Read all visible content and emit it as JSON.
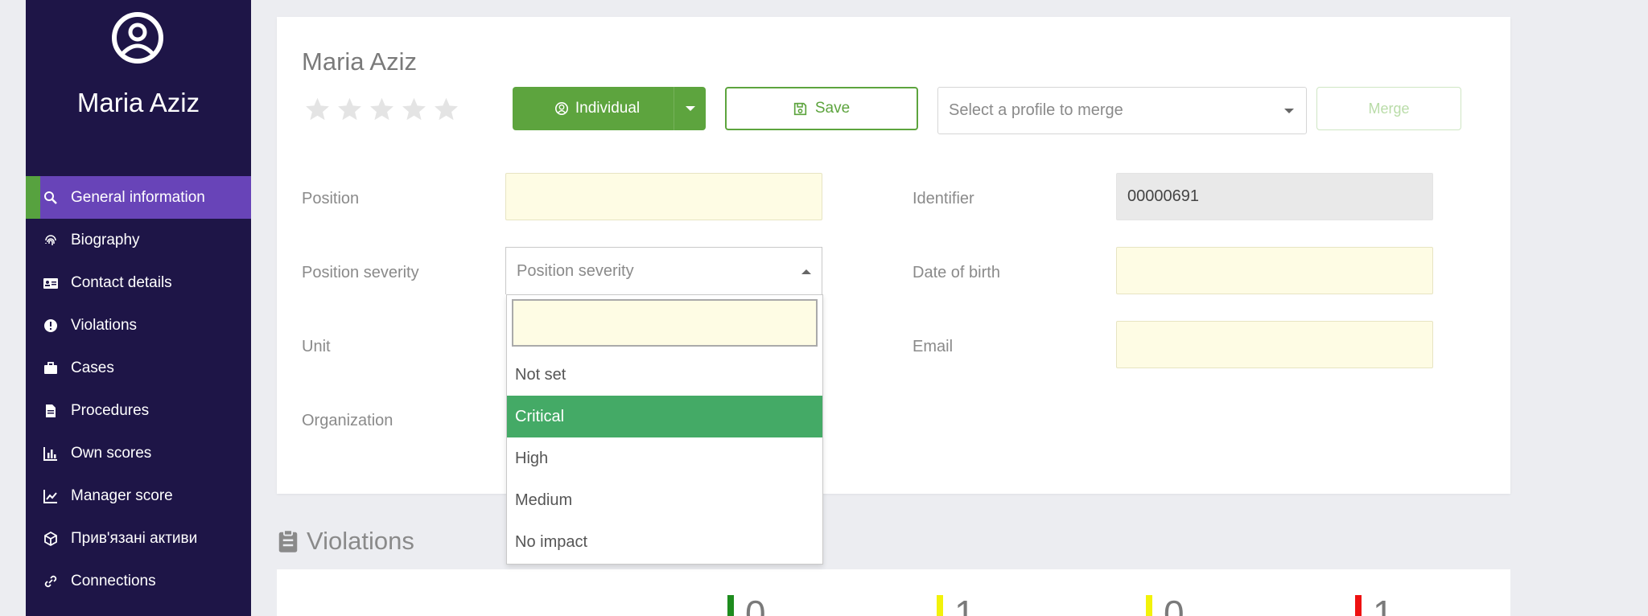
{
  "sidebar": {
    "user_name": "Maria Aziz",
    "items": [
      {
        "label": "General information",
        "icon": "search-user-icon",
        "active": true
      },
      {
        "label": "Biography",
        "icon": "fingerprint-icon"
      },
      {
        "label": "Contact details",
        "icon": "id-card-icon"
      },
      {
        "label": "Violations",
        "icon": "exclamation-icon"
      },
      {
        "label": "Cases",
        "icon": "briefcase-icon"
      },
      {
        "label": "Procedures",
        "icon": "document-icon"
      },
      {
        "label": "Own scores",
        "icon": "bar-chart-icon"
      },
      {
        "label": "Manager score",
        "icon": "line-chart-icon"
      },
      {
        "label": "Прив'язані активи",
        "icon": "cube-icon"
      },
      {
        "label": "Connections",
        "icon": "link-icon"
      }
    ]
  },
  "profile": {
    "title": "Maria Aziz",
    "rating": 0,
    "rating_max": 5,
    "individual_label": "Individual",
    "save_label": "Save",
    "merge_placeholder": "Select a profile to merge",
    "merge_label": "Merge"
  },
  "form": {
    "position_label": "Position",
    "position_value": "",
    "position_severity_label": "Position severity",
    "position_severity_placeholder": "Position severity",
    "unit_label": "Unit",
    "organization_label": "Organization",
    "identifier_label": "Identifier",
    "identifier_value": "00000691",
    "dob_label": "Date of birth",
    "email_label": "Email"
  },
  "severity_dropdown": {
    "search_value": "",
    "options": [
      "Not set",
      "Critical",
      "High",
      "Medium",
      "No impact"
    ],
    "highlighted": "Critical"
  },
  "violations": {
    "title": "Violations",
    "stats": [
      {
        "value": "0",
        "color": "#1e8c1e"
      },
      {
        "value": "1",
        "color": "#f2f20a"
      },
      {
        "value": "0",
        "color": "#f2f20a"
      },
      {
        "value": "1",
        "color": "#ee1111"
      }
    ]
  },
  "colors": {
    "sidebar_bg": "#1e1547",
    "active_item": "#6844b8",
    "accent_green": "#5da43e",
    "highlight_green": "#44aa66"
  }
}
